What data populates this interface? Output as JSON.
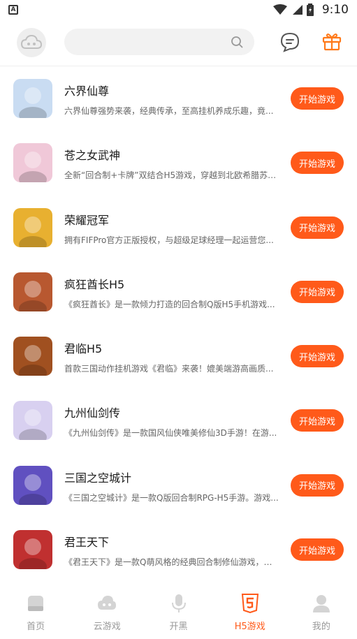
{
  "status_bar": {
    "time": "9:10"
  },
  "header": {
    "search_placeholder": ""
  },
  "games": [
    {
      "name": "六界仙尊",
      "desc": "六界仙尊强势来袭，经典传承，至高挂机养成乐趣，竟...",
      "button": "开始游戏",
      "color": "#c9dcf2"
    },
    {
      "name": "苍之女武神",
      "desc": "全新“回合制+卡牌”双结合H5游戏，穿越到北欧希腊苏美...",
      "button": "开始游戏",
      "color": "#f0c8d8"
    },
    {
      "name": "荣耀冠军",
      "desc": "拥有FIFPro官方正版授权，与超级足球经理一起运营您...",
      "button": "开始游戏",
      "color": "#e8b030"
    },
    {
      "name": "疯狂酋长H5",
      "desc": "《疯狂酋长》是一款倾力打造的回合制Q版H5手机游戏...",
      "button": "开始游戏",
      "color": "#b85830"
    },
    {
      "name": "君临H5",
      "desc": "首款三国动作挂机游戏《君临》来袭！媲美端游高画质...",
      "button": "开始游戏",
      "color": "#a05020"
    },
    {
      "name": "九州仙剑传",
      "desc": "《九州仙剑传》是一款国风仙侠唯美修仙3D手游！在游...",
      "button": "开始游戏",
      "color": "#d8d0f0"
    },
    {
      "name": "三国之空城计",
      "desc": "《三国之空城计》是一款Q版回合制RPG-H5手游。游戏...",
      "button": "开始游戏",
      "color": "#6050c0"
    },
    {
      "name": "君王天下",
      "desc": "《君王天下》是一款Q萌风格的经典回合制修仙游戏，题...",
      "button": "开始游戏",
      "color": "#c03030"
    }
  ],
  "bottom_nav": [
    {
      "label": "首页",
      "icon": "home-icon",
      "active": false
    },
    {
      "label": "云游戏",
      "icon": "cloud-icon",
      "active": false
    },
    {
      "label": "开黑",
      "icon": "microphone-icon",
      "active": false
    },
    {
      "label": "H5游戏",
      "icon": "html5-icon",
      "active": true
    },
    {
      "label": "我的",
      "icon": "user-icon",
      "active": false
    }
  ],
  "colors": {
    "accent": "#ff5a1a",
    "inactive": "#cccccc"
  }
}
